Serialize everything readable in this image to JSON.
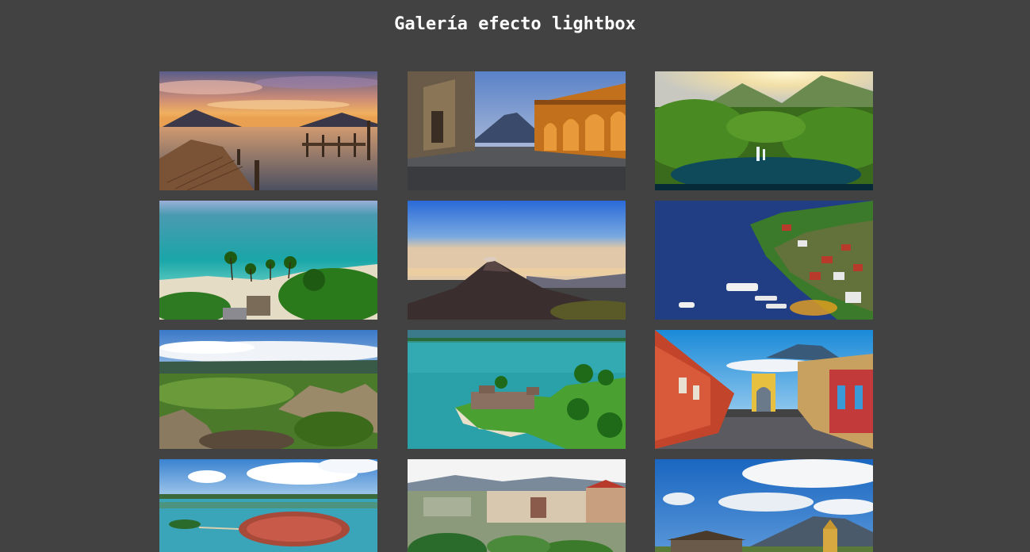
{
  "header": {
    "title": "Galería efecto lightbox"
  },
  "gallery": {
    "items": [
      {
        "scene": "lake-dock-volcanoes-sunset"
      },
      {
        "scene": "colonial-street-volcano"
      },
      {
        "scene": "jungle-waterfall-lagoon"
      },
      {
        "scene": "caribbean-beach-palms"
      },
      {
        "scene": "volcano-summit-sunrise"
      },
      {
        "scene": "lakeside-town-boats"
      },
      {
        "scene": "highlands-rocks-clouds"
      },
      {
        "scene": "lake-fortress-island"
      },
      {
        "scene": "colorful-street-arch-volcano"
      },
      {
        "scene": "island-town-lake"
      },
      {
        "scene": "plaza-colonial-buildings"
      },
      {
        "scene": "sky-clouds-volcano-church"
      }
    ]
  }
}
